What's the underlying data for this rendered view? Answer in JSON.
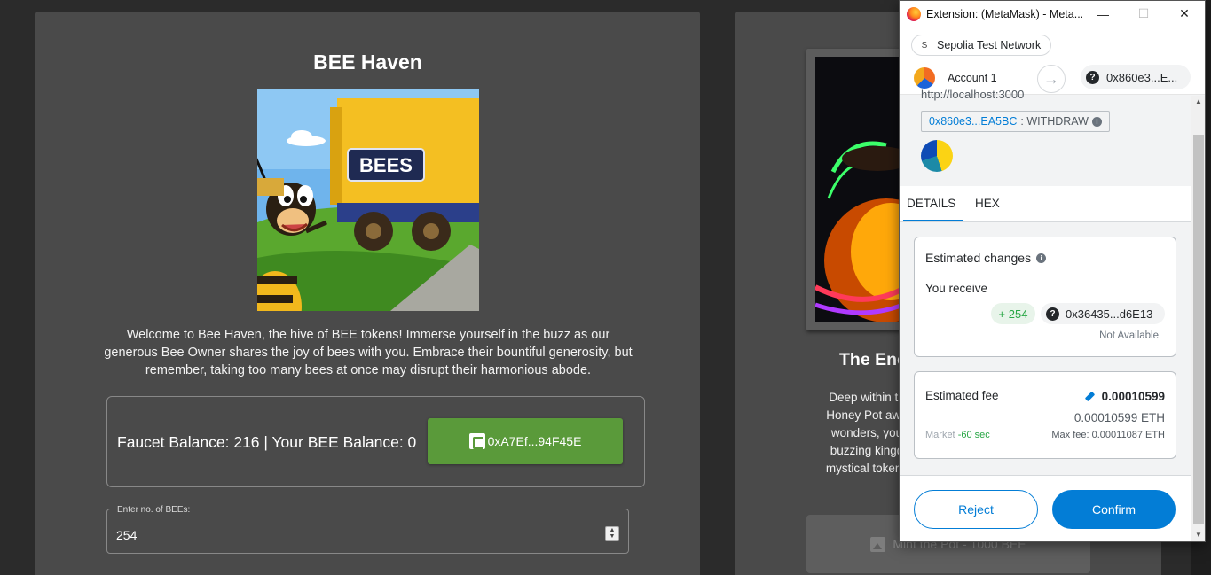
{
  "left_card": {
    "title": "BEE Haven",
    "hero_sign": "BEES",
    "intro": "Welcome to Bee Haven, the hive of BEE tokens! Immerse yourself in the buzz as our generous Bee Owner shares the joy of bees with you. Embrace their bountiful generosity, but remember, taking too many bees at once may disrupt their harmonious abode.",
    "balance_text": "Faucet Balance: 216 | Your BEE Balance: 0",
    "wallet_button": "0xA7Ef...94F45E",
    "bees_field_label": "Enter no. of BEEs:",
    "bees_field_value": "254"
  },
  "right_card": {
    "title": "The Enc",
    "lines": [
      "Deep within th",
      "Honey Pot awa",
      "wonders, you",
      "buzzing kingd",
      "mystical tokens"
    ],
    "mint_button": "Mint the Pot - 1000 BEE"
  },
  "metamask": {
    "window_title": "Extension: (MetaMask) - Meta...",
    "network": "Sepolia Test Network",
    "network_initial": "S",
    "account_name": "Account 1",
    "dest_address": "0x860e3...E...",
    "origin_url": "http://localhost:3000",
    "method_address": "0x860e3...EA5BC",
    "method_name": ": WITHDRAW",
    "tabs": [
      "DETAILS",
      "HEX"
    ],
    "estimated_changes_title": "Estimated changes",
    "you_receive_label": "You receive",
    "receive_amount": "+ 254",
    "receive_token": "0x36435...d6E13",
    "not_available": "Not Available",
    "estimated_fee_label": "Estimated fee",
    "fee_value": "0.00010599",
    "fee_eth": "0.00010599 ETH",
    "market_label": "Market",
    "market_time": "-60 sec",
    "max_fee": "Max fee: 0.00011087 ETH",
    "reject_label": "Reject",
    "confirm_label": "Confirm"
  },
  "colors": {
    "metamask_blue": "#037dd6",
    "wallet_green": "#5a9a3a",
    "card_bg": "#4a4a4a",
    "page_bg": "#2b2b2b"
  }
}
